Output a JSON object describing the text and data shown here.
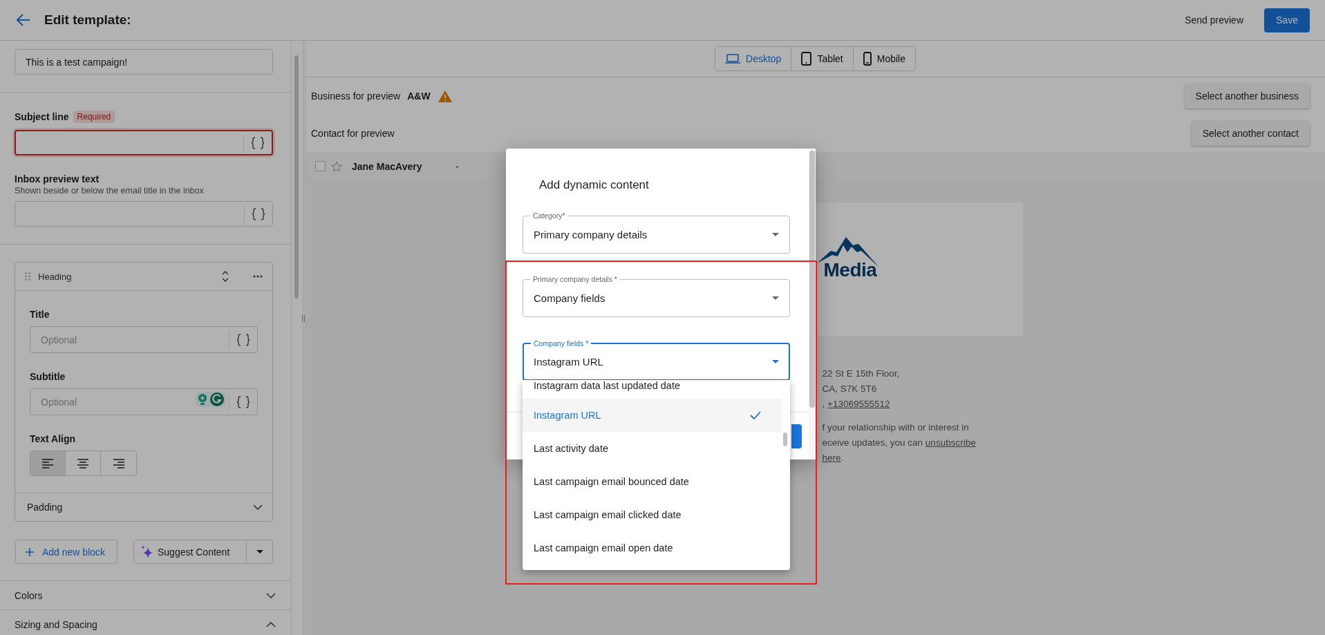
{
  "header": {
    "title": "Edit template:",
    "actions": [
      {
        "label": "Send preview",
        "kind": "text"
      },
      {
        "label": "Save",
        "kind": "primary"
      }
    ]
  },
  "sidebar": {
    "campaign_field": {
      "value": "This is a test campaign!"
    },
    "subject_line": {
      "label": "Subject line",
      "badge": "Required",
      "invalid": true
    },
    "inbox_preview": {
      "label": "Inbox preview text",
      "hint": "Shown beside or below the email title in the inbox"
    },
    "block": {
      "title": "Heading",
      "fields": [
        {
          "label": "Title",
          "placeholder": "Optional",
          "grammarly": false
        },
        {
          "label": "Subtitle",
          "placeholder": "Optional",
          "grammarly": true
        }
      ],
      "text_align": {
        "label": "Text Align",
        "options": [
          {
            "kind": "left",
            "selected": true
          },
          {
            "kind": "center",
            "selected": false
          },
          {
            "kind": "right",
            "selected": false
          }
        ]
      },
      "padding": {
        "label": "Padding",
        "expanded": false
      }
    },
    "add_button": "Add new block",
    "suggest_button": "Suggest Content",
    "sections": [
      {
        "label": "Colors",
        "expanded": false
      },
      {
        "label": "Sizing and Spacing",
        "expanded": true
      }
    ]
  },
  "preview": {
    "devices": [
      {
        "label": "Desktop",
        "kind": "laptop",
        "selected": true
      },
      {
        "label": "Tablet",
        "kind": "tablet",
        "selected": false
      },
      {
        "label": "Mobile",
        "kind": "phone",
        "selected": false
      }
    ],
    "business": {
      "label": "Business for preview",
      "name": "A&W",
      "warning": true,
      "button": "Select another business"
    },
    "contact": {
      "label": "Contact for preview",
      "button": "Select another contact",
      "rows": [
        {
          "name": "Jane MacAvery",
          "detail": "-",
          "checked": false,
          "starred": false
        }
      ]
    },
    "email": {
      "logo_text": "Media",
      "lines": [
        {
          "text": "22 St E 15th Floor,"
        },
        {
          "text": "CA, S7K 5T6"
        },
        {
          "text": ", ",
          "link": "+13069555512"
        },
        {
          "text": "f your relationship with or interest in"
        },
        {
          "text": "eceive updates, you can ",
          "link": "unsubscribe"
        },
        {
          "link": "here",
          "after": "."
        }
      ]
    }
  },
  "modal": {
    "title": "Add dynamic content",
    "fields": [
      {
        "label": "Category*",
        "value": "Primary company details",
        "focused": false
      },
      {
        "label": "Primary company details *",
        "value": "Company fields",
        "focused": false
      },
      {
        "label": "Company fields *",
        "value": "Instagram URL",
        "focused": true
      }
    ],
    "options": [
      {
        "label": "Instagram data last updated date",
        "selected": false
      },
      {
        "label": "Instagram URL",
        "selected": true
      },
      {
        "label": "Last activity date",
        "selected": false
      },
      {
        "label": "Last campaign email bounced date",
        "selected": false
      },
      {
        "label": "Last campaign email clicked date",
        "selected": false
      },
      {
        "label": "Last campaign email open date",
        "selected": false
      }
    ]
  }
}
